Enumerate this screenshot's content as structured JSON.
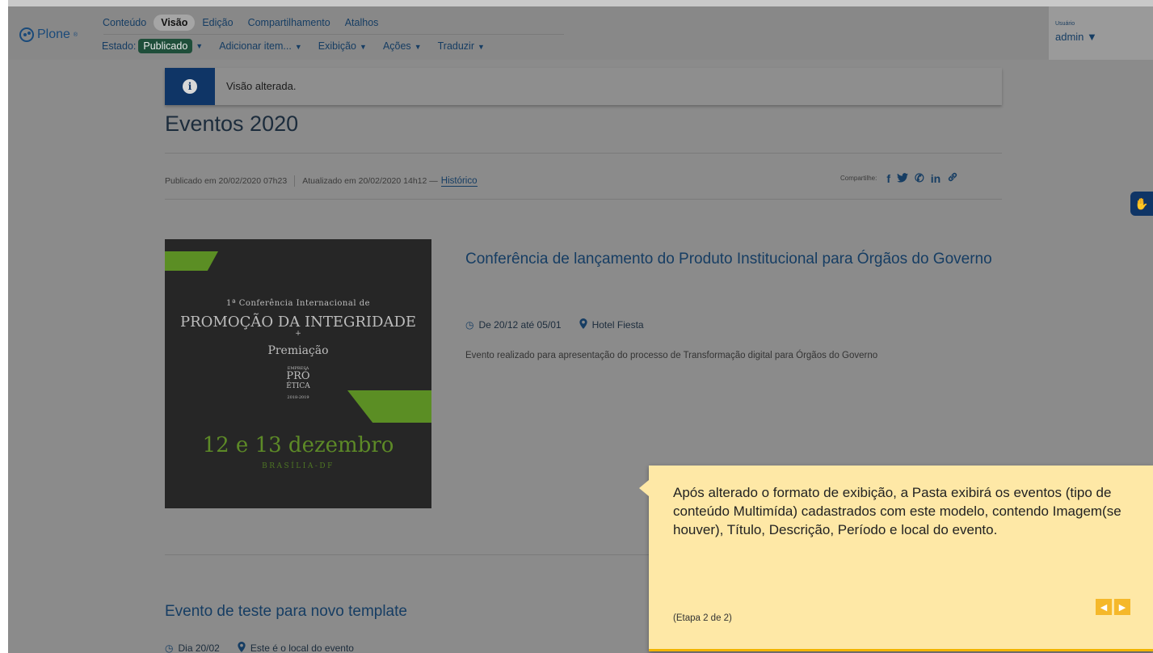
{
  "toolbar": {
    "logo_text": "Plone",
    "logo_sup": "®",
    "tabs": [
      "Conteúdo",
      "Visão",
      "Edição",
      "Compartilhamento",
      "Atalhos"
    ],
    "active_tab": "Visão",
    "state_label": "Estado:",
    "state_value": "Publicado",
    "actions": [
      "Adicionar item...",
      "Exibição",
      "Ações",
      "Traduzir"
    ],
    "caret": "▼",
    "user_label": "Usuário",
    "user_name": "admin ▼"
  },
  "alert": {
    "icon": "info-icon",
    "icon_glyph": "i",
    "message": "Visão alterada."
  },
  "page": {
    "title": "Eventos 2020",
    "published": "Publicado em 20/02/2020 07h23",
    "updated": "Atualizado em 20/02/2020 14h12 —",
    "history_link": "Histórico",
    "share_label": "Compartilhe:",
    "share_icons": [
      "facebook-icon",
      "twitter-icon",
      "whatsapp-icon",
      "linkedin-icon",
      "link-icon"
    ],
    "share_glyphs": [
      "f",
      "🐦",
      "✆",
      "in",
      "🔗"
    ]
  },
  "events": [
    {
      "title": "Conferência de lançamento do Produto Institucional para Órgãos do Governo",
      "period_icon": "clock-icon",
      "period": "De 20/12 até 05/01",
      "location_icon": "map-pin-icon",
      "location": "Hotel Fiesta",
      "description": "Evento realizado para apresentação do processo de Transformação digital para Órgãos do Governo",
      "image": {
        "line1": "1ª Conferência Internacional de",
        "line2": "PROMOÇÃO DA INTEGRIDADE",
        "line3": "+",
        "line4": "Premiação",
        "line5": "EMPRESA",
        "line6": "PRÓ",
        "line7": "ÉTICA",
        "line8": "2018-2019",
        "line9": "12 e 13 dezembro",
        "line10": "BRASÍLIA-DF"
      }
    },
    {
      "title": "Evento de teste para novo template",
      "period_icon": "clock-icon",
      "period": "Dia 20/02",
      "location_icon": "map-pin-icon",
      "location": "Este é o local do evento"
    }
  ],
  "side_button_icon": "accessibility-hand-icon",
  "tour": {
    "text": "Após alterado o formato de exibição, a Pasta exibirá os eventos (tipo de conteúdo Multimída) cadastrados com este modelo, contendo Imagem(se houver), Título, Descrição, Período e local do evento.",
    "step": "(Etapa 2 de 2)",
    "prev_icon": "arrow-left-icon",
    "next_icon": "arrow-right-icon"
  }
}
